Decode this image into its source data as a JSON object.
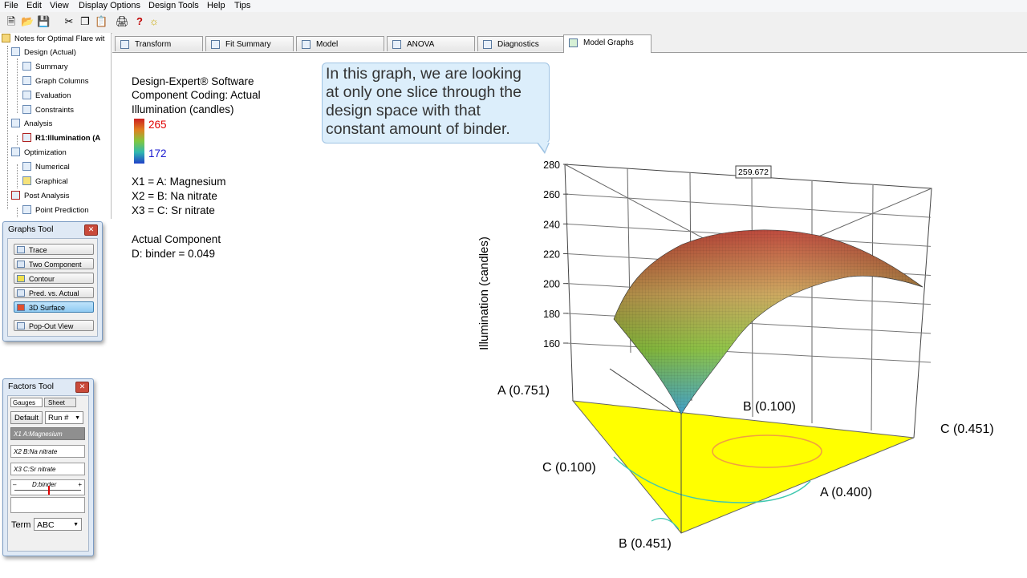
{
  "menu": [
    "File",
    "Edit",
    "View",
    "Display Options",
    "Design Tools",
    "Help",
    "Tips"
  ],
  "tree": {
    "root": "Notes for Optimal Flare wit",
    "items": [
      {
        "label": "Design (Actual)",
        "level": 1
      },
      {
        "label": "Summary",
        "level": 2
      },
      {
        "label": "Graph Columns",
        "level": 2
      },
      {
        "label": "Evaluation",
        "level": 2
      },
      {
        "label": "Constraints",
        "level": 2
      },
      {
        "label": "Analysis",
        "level": 1
      },
      {
        "label": "R1:Illumination (A",
        "level": 2
      },
      {
        "label": "Optimization",
        "level": 1
      },
      {
        "label": "Numerical",
        "level": 2
      },
      {
        "label": "Graphical",
        "level": 2
      },
      {
        "label": "Post Analysis",
        "level": 1
      },
      {
        "label": "Point Prediction",
        "level": 2
      }
    ]
  },
  "graphs_tool": {
    "title": "Graphs Tool",
    "buttons": [
      "Trace",
      "Two Component",
      "Contour",
      "Pred. vs. Actual",
      "3D Surface",
      "Pop-Out View"
    ],
    "selected": "3D Surface"
  },
  "factors_tool": {
    "title": "Factors Tool",
    "tab_gauges": "Gauges",
    "tab_sheet": "Sheet",
    "default_label": "Default",
    "run_label": "Run #",
    "factors": [
      {
        "code": "X1",
        "name": "A:Magnesium"
      },
      {
        "code": "X2",
        "name": "B:Na nitrate"
      },
      {
        "code": "X3",
        "name": "C:Sr nitrate"
      }
    ],
    "slider_label": "D:binder",
    "slider_minus": "–",
    "slider_plus": "+",
    "slider_value": 0.5,
    "term_label": "Term",
    "term_value": "ABC"
  },
  "tabs": [
    {
      "label": "Transform",
      "active": false
    },
    {
      "label": "Fit Summary",
      "active": false
    },
    {
      "label": "Model",
      "active": false
    },
    {
      "label": "ANOVA",
      "active": false
    },
    {
      "label": "Diagnostics",
      "active": false
    },
    {
      "label": "Model Graphs",
      "active": true
    }
  ],
  "legend_info": {
    "software": "Design-Expert® Software",
    "coding": "Component Coding: Actual",
    "response": "Illumination (candles)",
    "color_high": "265",
    "color_low": "172",
    "x1": "X1 = A: Magnesium",
    "x2": "X2 = B: Na nitrate",
    "x3": "X3 = C: Sr nitrate",
    "actual_title": "Actual Component",
    "actual_value": "D: binder = 0.049"
  },
  "callout": {
    "lines": [
      "In this graph, we are looking",
      "at only one slice through the",
      "design space with that",
      "constant amount of binder."
    ]
  },
  "chart_data": {
    "type": "3d-surface",
    "z_label": "Illumination (candles)",
    "z_ticks": [
      "280",
      "260",
      "240",
      "220",
      "200",
      "180",
      "160"
    ],
    "z_range": [
      150,
      280
    ],
    "peak_label": "259.672",
    "vertex_labels": {
      "a_high": "A (0.751)",
      "b_low": "B (0.100)",
      "c_high": "C (0.451)",
      "c_low": "C (0.100)",
      "a_low": "A (0.400)",
      "b_high": "B (0.451)"
    },
    "colors": {
      "high": "#c8281e",
      "mid": "#8cc83c",
      "low": "#1e64c8",
      "floor": "#ffff00",
      "contour_orange": "#f0a040",
      "contour_cyan": "#40c8b0"
    }
  }
}
